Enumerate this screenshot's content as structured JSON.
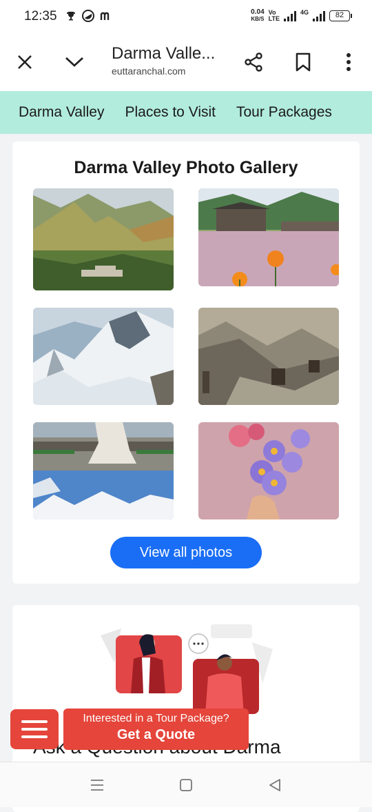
{
  "status": {
    "time": "12:35",
    "net_speed_value": "0.04",
    "net_speed_unit": "KB/S",
    "volte_top": "Vo",
    "volte_bottom": "LTE",
    "network_type": "4G",
    "battery": "82"
  },
  "toolbar": {
    "page_title": "Darma Valle...",
    "url": "euttaranchal.com"
  },
  "nav": {
    "items": [
      "Darma Valley",
      "Places to Visit",
      "Tour Packages"
    ]
  },
  "gallery": {
    "title": "Darma Valley Photo Gallery",
    "view_all_label": "View all photos"
  },
  "ask": {
    "heading": "Ask a Question about Darma"
  },
  "quote": {
    "subtitle": "Interested in a Tour Package?",
    "button_label": "Get a Quote"
  },
  "colors": {
    "nav_strip": "#b2ecdc",
    "accent_blue": "#1a6ef5",
    "cta_red": "#e5453a"
  }
}
